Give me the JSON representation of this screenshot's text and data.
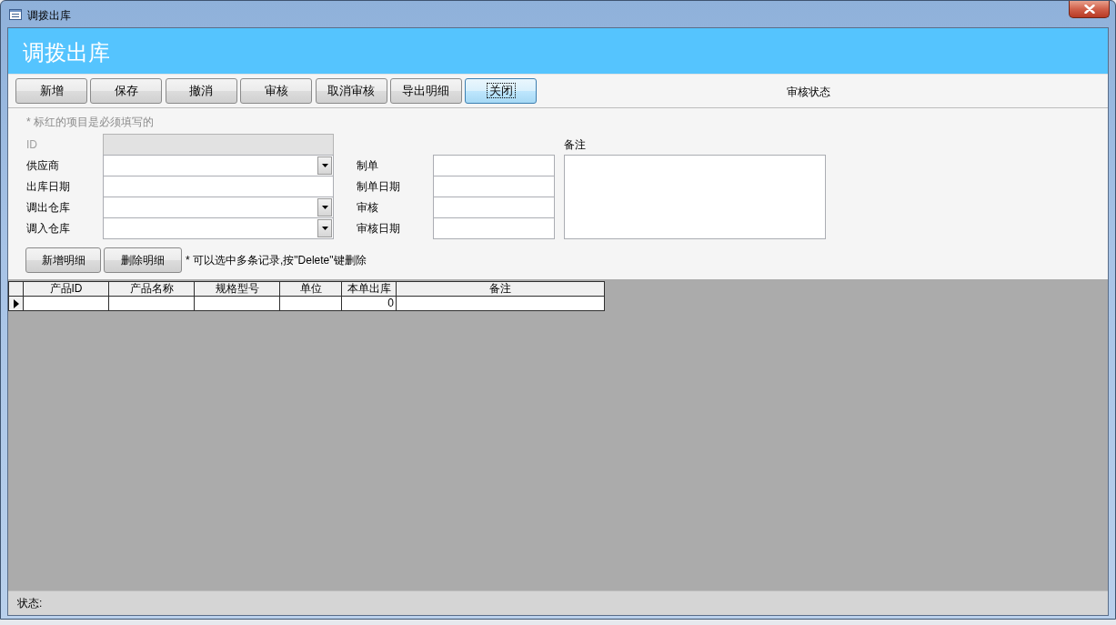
{
  "window": {
    "title": "调拨出库"
  },
  "header": {
    "title": "调拨出库"
  },
  "toolbar": {
    "buttons": [
      {
        "label": "新增",
        "focused": false
      },
      {
        "label": "保存",
        "focused": false
      },
      {
        "label": "撤消",
        "focused": false
      },
      {
        "label": "审核",
        "focused": false
      },
      {
        "label": "取消审核",
        "focused": false
      },
      {
        "label": "导出明细",
        "focused": false
      },
      {
        "label": "关闭",
        "focused": true
      }
    ],
    "status_label": "审核状态"
  },
  "form": {
    "hint": "* 标红的项目是必须填写的",
    "left_fields": [
      {
        "label": "ID",
        "kind": "text",
        "disabled": true
      },
      {
        "label": "供应商",
        "kind": "dropdown",
        "disabled": false
      },
      {
        "label": "出库日期",
        "kind": "text",
        "disabled": false
      },
      {
        "label": "调出仓库",
        "kind": "dropdown",
        "disabled": false
      },
      {
        "label": "调入仓库",
        "kind": "dropdown",
        "disabled": false
      }
    ],
    "right_fields": [
      {
        "label": "制单"
      },
      {
        "label": "制单日期"
      },
      {
        "label": "审核"
      },
      {
        "label": "审核日期"
      }
    ],
    "notes": {
      "label": "备注"
    }
  },
  "detail": {
    "buttons": [
      "新增明细",
      "删除明细"
    ],
    "note": "* 可以选中多条记录,按\"Delete\"键删除"
  },
  "table": {
    "columns": [
      {
        "label": "产品ID",
        "kind": "text"
      },
      {
        "label": "产品名称",
        "kind": "text"
      },
      {
        "label": "规格型号",
        "kind": "text"
      },
      {
        "label": "单位",
        "kind": "text"
      },
      {
        "label": "本单出库",
        "kind": "number"
      },
      {
        "label": "备注",
        "kind": "text"
      }
    ],
    "rows": [
      {
        "current": true,
        "cells": [
          null,
          null,
          null,
          null,
          "0",
          null
        ]
      }
    ]
  },
  "status_bar": {
    "label": "状态:"
  }
}
